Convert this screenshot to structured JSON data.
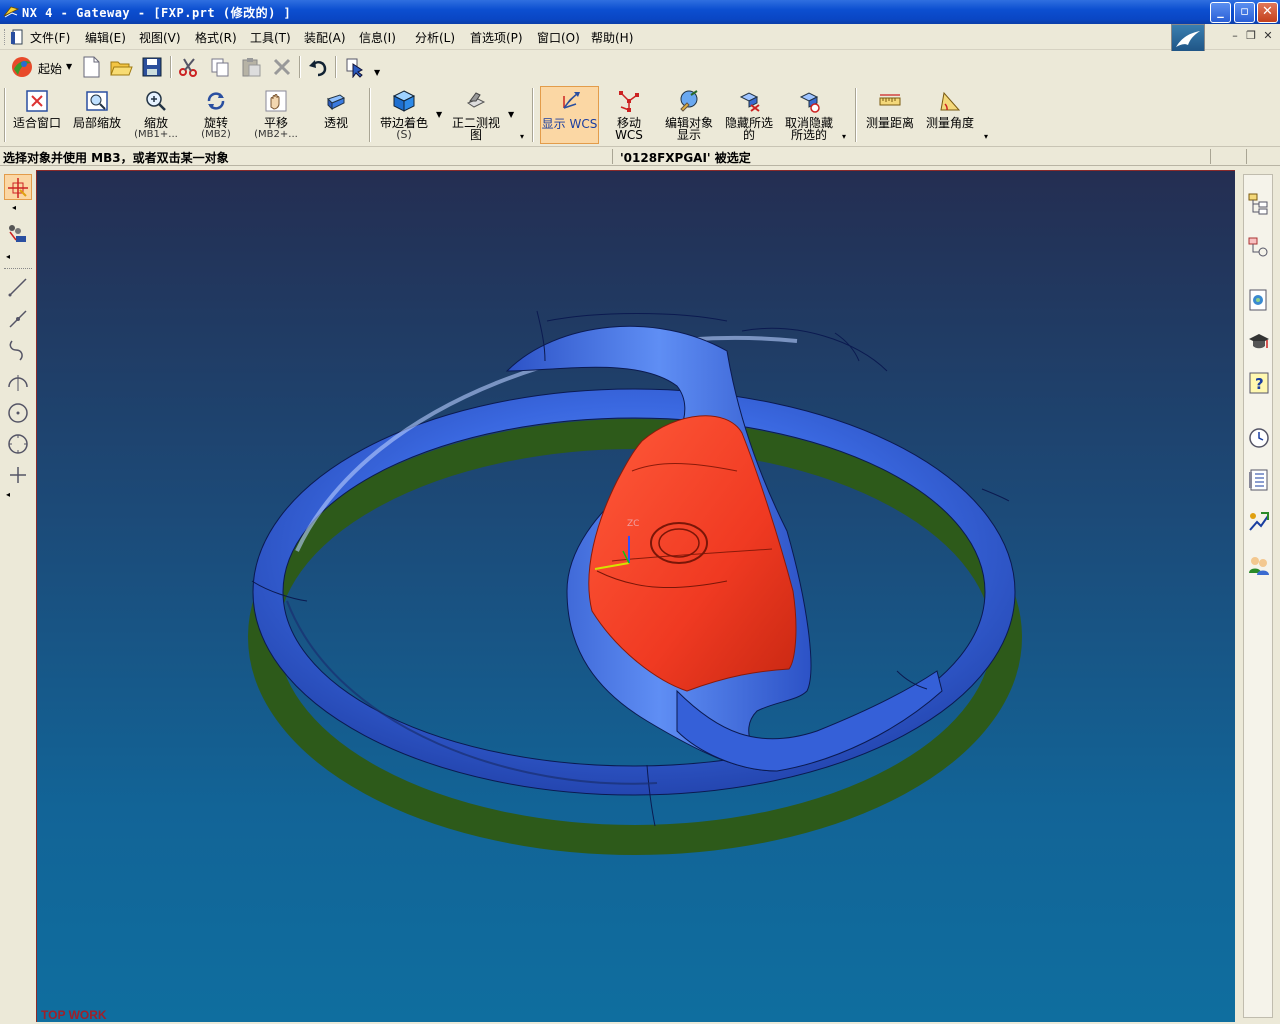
{
  "window": {
    "title": "NX 4 - Gateway - [FXP.prt (修改的) ]"
  },
  "menu": {
    "items": [
      "文件(F)",
      "编辑(E)",
      "视图(V)",
      "格式(R)",
      "工具(T)",
      "装配(A)",
      "信息(I)",
      "分析(L)",
      "首选项(P)",
      "窗口(O)",
      "帮助(H)"
    ]
  },
  "standard_toolbar": {
    "start_label": "起始"
  },
  "view_toolbar": {
    "fit": "适合窗口",
    "zoom_region": "局部缩放",
    "zoom": "缩放",
    "zoom_sub": "(MB1+...",
    "rotate": "旋转",
    "rotate_sub": "(MB2)",
    "pan": "平移",
    "pan_sub": "(MB2+...",
    "perspective": "透视",
    "shaded_edges": "带边着色",
    "shaded_edges_sub": "(S)",
    "trimetric": "正二测视",
    "trimetric_2": "图",
    "display_wcs": "显示 WCS",
    "move_wcs": "移动 WCS",
    "edit_display": "编辑对象",
    "edit_display_2": "显示",
    "hide_selected": "隐藏所选",
    "hide_selected_2": "的",
    "unhide_selected": "取消隐藏",
    "unhide_selected_2": "所选的",
    "measure_distance": "测量距离",
    "measure_angle": "测量角度"
  },
  "status": {
    "cue": "选择对象并使用 MB3，或者双击某一对象",
    "message": "'0128FXPGAI' 被选定"
  },
  "graphics": {
    "watermark": "TOP WORK",
    "wcs_label": "ZC",
    "background_top": "#242e52",
    "background_bottom": "#0f6e9f",
    "body_color": "#3a68e0",
    "selected_color": "#f03a22"
  }
}
